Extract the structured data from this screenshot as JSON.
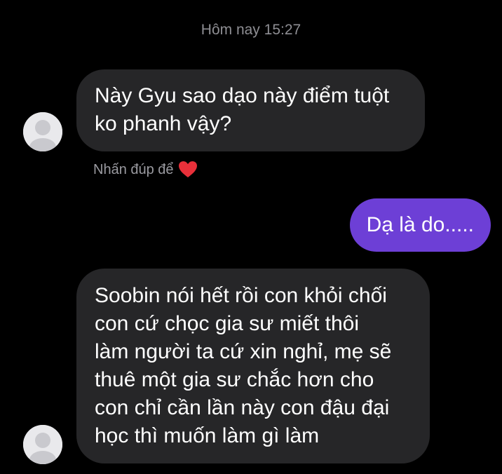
{
  "conversation": {
    "timestamp": "Hôm nay 15:27",
    "messages": [
      {
        "direction": "incoming",
        "lines": [
          "Này Gyu sao dạo này điểm tuột",
          "ko phanh vậy?"
        ]
      },
      {
        "direction": "outgoing",
        "lines": [
          "Dạ là do....."
        ]
      },
      {
        "direction": "incoming",
        "lines": [
          "Soobin nói hết rồi con khỏi chối",
          "con cứ chọc gia sư miết thôi",
          "làm người ta cứ xin nghỉ, mẹ sẽ",
          "thuê một gia sư chắc hơn cho",
          "con chỉ cần lần này con đậu đại",
          "học thì muốn làm gì làm"
        ]
      }
    ],
    "reaction_hint": {
      "text": "Nhấn đúp để",
      "icon": "heart-icon"
    }
  },
  "colors": {
    "background": "#000000",
    "incoming_bubble": "#262628",
    "outgoing_bubble": "#6d3fd6",
    "heart": "#e8303a",
    "timestamp_text": "#8e8e93"
  }
}
